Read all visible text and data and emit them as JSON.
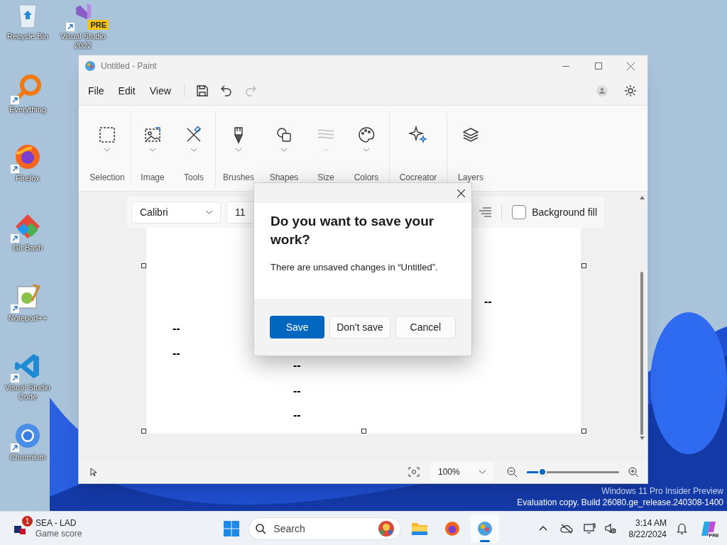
{
  "desktop_icons": [
    {
      "kind": "recycle",
      "label": "Recycle Bin",
      "shortcut": false
    },
    {
      "kind": "vs",
      "label": "Visual Studio 2022",
      "badge": "PRE",
      "shortcut": true
    },
    {
      "kind": "everything",
      "label": "Everything",
      "shortcut": true
    },
    {
      "kind": "firefox",
      "label": "Firefox",
      "shortcut": true
    },
    {
      "kind": "git",
      "label": "Git Bash",
      "shortcut": true
    },
    {
      "kind": "notepad",
      "label": "Notepad++",
      "shortcut": true
    },
    {
      "kind": "vscode",
      "label": "Visual Studio Code",
      "shortcut": true
    },
    {
      "kind": "chromium",
      "label": "Chromium",
      "shortcut": true
    }
  ],
  "window": {
    "title": "Untitled - Paint",
    "menu": [
      "File",
      "Edit",
      "View"
    ],
    "quick_tools": [
      {
        "kind": "save",
        "disabled": false
      },
      {
        "kind": "undo",
        "disabled": false
      },
      {
        "kind": "redo",
        "disabled": true
      }
    ],
    "ribbon": [
      {
        "kind": "selection",
        "label": "Selection",
        "dropdown": true,
        "disabled": false
      },
      {
        "kind": "image",
        "label": "Image",
        "dropdown": true,
        "disabled": false
      },
      {
        "kind": "tools",
        "label": "Tools",
        "dropdown": true,
        "disabled": false
      },
      {
        "kind": "brushes",
        "label": "Brushes",
        "dropdown": true,
        "disabled": false
      },
      {
        "kind": "shapes",
        "label": "Shapes",
        "dropdown": true,
        "disabled": false
      },
      {
        "kind": "size",
        "label": "Size",
        "dropdown": true,
        "disabled": true
      },
      {
        "kind": "colors",
        "label": "Colors",
        "dropdown": true,
        "disabled": false
      },
      {
        "kind": "cocreator",
        "label": "Cocreator",
        "dropdown": false,
        "disabled": false
      },
      {
        "kind": "layers",
        "label": "Layers",
        "dropdown": false,
        "disabled": false
      }
    ],
    "text_toolbar": {
      "font": "Calibri",
      "size": "11",
      "background_fill": {
        "label": "Background fill",
        "checked": false
      }
    },
    "canvas_marks": [
      "--",
      "--",
      "--",
      "--",
      "--",
      "--"
    ],
    "status_bar": {
      "zoom": "100%",
      "zoom_slider": {
        "level": 0.17
      }
    }
  },
  "dialog": {
    "title": "Do you want to save your work?",
    "message": "There are unsaved changes in “Untitled”.",
    "buttons": [
      {
        "label": "Save",
        "kind": "primary"
      },
      {
        "label": "Don't save",
        "kind": "secondary"
      },
      {
        "label": "Cancel",
        "kind": "secondary"
      }
    ]
  },
  "watermark": [
    "Windows 11 Pro Insider Preview",
    "Evaluation copy. Build 26080.ge_release.240308-1400"
  ],
  "taskbar": {
    "widget": {
      "title": "SEA - LAD",
      "subtitle": "Game score",
      "badge": "1"
    },
    "search": {
      "placeholder": "Search"
    },
    "apps": [
      {
        "kind": "explorer",
        "selected": false
      },
      {
        "kind": "firefox",
        "selected": false
      },
      {
        "kind": "paint",
        "selected": true
      }
    ],
    "time": "3:14 AM",
    "date": "8/22/2024",
    "copilot_badge": "PRE"
  }
}
